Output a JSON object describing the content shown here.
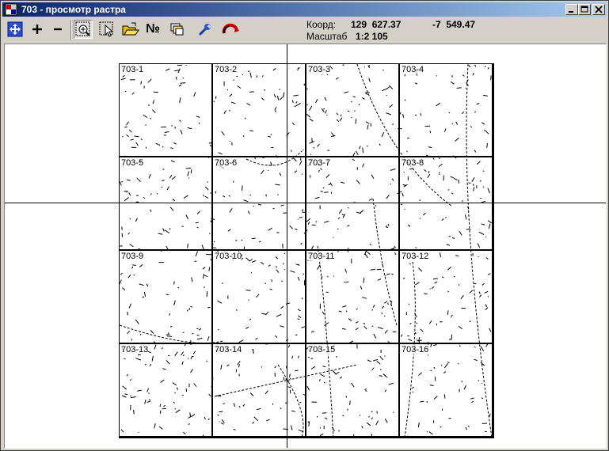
{
  "window": {
    "title": "703 - просмотр растра",
    "controls": {
      "minimize": "minimize",
      "maximize": "maximize",
      "close": "close"
    }
  },
  "toolbar": {
    "buttons": [
      {
        "name": "pan-all-button",
        "icon": "move-arrows-icon"
      },
      {
        "name": "zoom-in-button",
        "icon": "plus-icon",
        "label": "+"
      },
      {
        "name": "zoom-out-button",
        "icon": "minus-icon",
        "label": "−"
      },
      {
        "name": "zoom-window-button",
        "icon": "zoom-rect-icon",
        "pressed": true
      },
      {
        "name": "select-button",
        "icon": "select-cursor-icon"
      },
      {
        "name": "open-button",
        "icon": "folder-open-icon"
      },
      {
        "name": "number-button",
        "icon": "number-sign-icon",
        "label": "№"
      },
      {
        "name": "copy-button",
        "icon": "copy-pages-icon"
      },
      {
        "name": "settings-button",
        "icon": "wrench-icon"
      },
      {
        "name": "exit-button",
        "icon": "red-arc-icon"
      }
    ]
  },
  "status": {
    "coord_label": "Коорд:",
    "coord_x": "129  627.37",
    "coord_y": "-7  549.47",
    "scale_label": "Масштаб",
    "scale_value": "1:2 105"
  },
  "raster": {
    "tiles": [
      "703-1",
      "703-2",
      "703-3",
      "703-4",
      "703-5",
      "703-6",
      "703-7",
      "703-8",
      "703-9",
      "703-10",
      "703-11",
      "703-12",
      "703-13",
      "703-14",
      "703-15",
      "703-16"
    ],
    "grid": {
      "rows": 4,
      "cols": 4
    }
  },
  "colors": {
    "title_start": "#0a246a",
    "title_end": "#a6caf0",
    "face": "#d4d0c8",
    "canvas": "#ffffff",
    "exit_icon": "#cc0000"
  }
}
